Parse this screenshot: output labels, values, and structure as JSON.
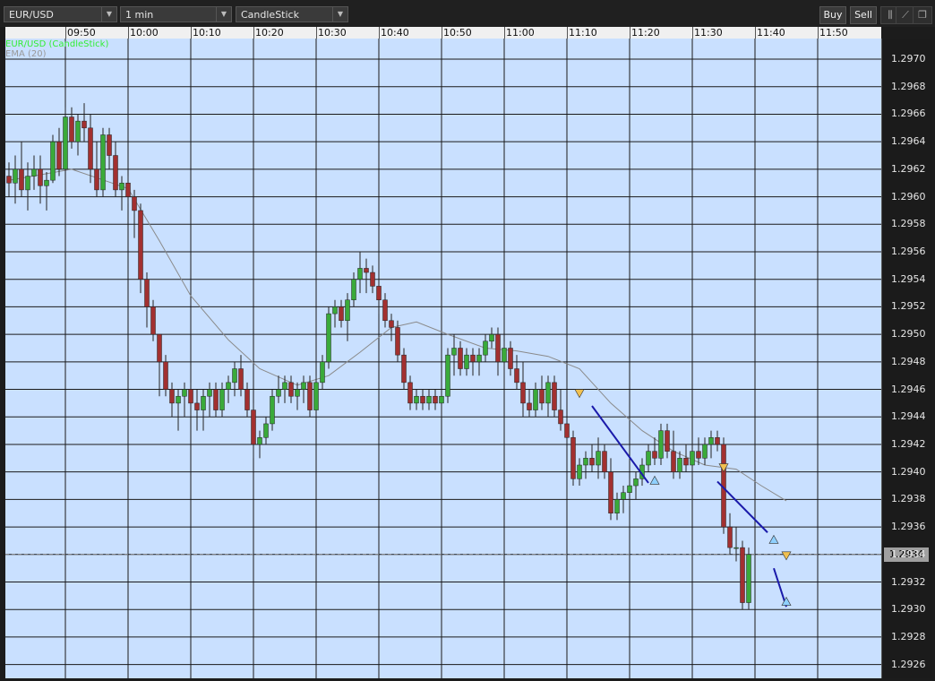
{
  "toolbar": {
    "symbol": "EUR/USD",
    "timeframe": "1 min",
    "chart_type": "CandleStick",
    "buy_label": "Buy",
    "sell_label": "Sell"
  },
  "colors": {
    "background": "#c9e0ff",
    "grid": "#1a1a1a",
    "bull": "#3aaa3a",
    "bear": "#a23030",
    "ema": "#8a8a8a",
    "trendline": "#1a1aaa",
    "signal_up": "#8fd0ff",
    "signal_down": "#f0c050",
    "symbol_legend": "#33ee33",
    "ema_legend": "#999999"
  },
  "legend": {
    "series": "EUR/USD (CandleStick)",
    "indicator": "EMA (20)"
  },
  "current_price": "1.2934",
  "chart_data": {
    "type": "candlestick",
    "x_ticks": [
      "09:50",
      "10:00",
      "10:10",
      "10:20",
      "10:30",
      "10:40",
      "10:50",
      "11:00",
      "11:10",
      "11:20",
      "11:30",
      "11:40",
      "11:50"
    ],
    "y_ticks": [
      "1.2970",
      "1.2968",
      "1.2966",
      "1.2964",
      "1.2962",
      "1.2960",
      "1.2958",
      "1.2956",
      "1.2954",
      "1.2952",
      "1.2950",
      "1.2948",
      "1.2946",
      "1.2944",
      "1.2942",
      "1.2940",
      "1.2938",
      "1.2936",
      "1.2934",
      "1.2932",
      "1.2930",
      "1.2928",
      "1.2926"
    ],
    "ylim": [
      1.2925,
      1.29715
    ],
    "x_start": "09:41",
    "interval_minutes": 1,
    "candles": [
      [
        1.29615,
        1.29625,
        1.296,
        1.2961
      ],
      [
        1.2961,
        1.2963,
        1.29595,
        1.2962
      ],
      [
        1.2962,
        1.2964,
        1.296,
        1.29605
      ],
      [
        1.29605,
        1.29625,
        1.2959,
        1.29615
      ],
      [
        1.29615,
        1.2963,
        1.29605,
        1.2962
      ],
      [
        1.2962,
        1.2963,
        1.29595,
        1.29608
      ],
      [
        1.29608,
        1.29618,
        1.2959,
        1.29612
      ],
      [
        1.29612,
        1.29645,
        1.2961,
        1.2964
      ],
      [
        1.2964,
        1.2965,
        1.29615,
        1.2962
      ],
      [
        1.2962,
        1.29665,
        1.29618,
        1.29658
      ],
      [
        1.29658,
        1.29665,
        1.29635,
        1.2964
      ],
      [
        1.2964,
        1.2966,
        1.2963,
        1.29655
      ],
      [
        1.29655,
        1.29668,
        1.2964,
        1.2965
      ],
      [
        1.2965,
        1.2966,
        1.2961,
        1.2962
      ],
      [
        1.2962,
        1.2964,
        1.296,
        1.29605
      ],
      [
        1.29605,
        1.2965,
        1.296,
        1.29645
      ],
      [
        1.29645,
        1.2965,
        1.2962,
        1.2963
      ],
      [
        1.2963,
        1.2964,
        1.296,
        1.29605
      ],
      [
        1.29605,
        1.29615,
        1.2959,
        1.2961
      ],
      [
        1.2961,
        1.29615,
        1.29595,
        1.296
      ],
      [
        1.296,
        1.29605,
        1.2957,
        1.2959
      ],
      [
        1.2959,
        1.29595,
        1.2953,
        1.2954
      ],
      [
        1.2954,
        1.29545,
        1.29505,
        1.2952
      ],
      [
        1.2952,
        1.29525,
        1.29495,
        1.295
      ],
      [
        1.295,
        1.295,
        1.29455,
        1.2948
      ],
      [
        1.2948,
        1.29485,
        1.29455,
        1.2946
      ],
      [
        1.2946,
        1.29465,
        1.2944,
        1.2945
      ],
      [
        1.2945,
        1.2946,
        1.2943,
        1.29455
      ],
      [
        1.29455,
        1.29465,
        1.2944,
        1.2946
      ],
      [
        1.2946,
        1.29465,
        1.2944,
        1.2945
      ],
      [
        1.2945,
        1.2946,
        1.2943,
        1.29445
      ],
      [
        1.29445,
        1.2946,
        1.2943,
        1.29455
      ],
      [
        1.29455,
        1.29465,
        1.2944,
        1.2946
      ],
      [
        1.2946,
        1.29465,
        1.2944,
        1.29445
      ],
      [
        1.29445,
        1.29465,
        1.2944,
        1.2946
      ],
      [
        1.2946,
        1.2947,
        1.2945,
        1.29465
      ],
      [
        1.29465,
        1.2948,
        1.29455,
        1.29475
      ],
      [
        1.29475,
        1.29485,
        1.29455,
        1.2946
      ],
      [
        1.2946,
        1.29465,
        1.2944,
        1.29445
      ],
      [
        1.29445,
        1.2945,
        1.2941,
        1.2942
      ],
      [
        1.2942,
        1.2943,
        1.2941,
        1.29425
      ],
      [
        1.29425,
        1.2944,
        1.2942,
        1.29435
      ],
      [
        1.29435,
        1.2946,
        1.2943,
        1.29455
      ],
      [
        1.29455,
        1.2947,
        1.2945,
        1.2946
      ],
      [
        1.2946,
        1.2947,
        1.2945,
        1.29465
      ],
      [
        1.29465,
        1.2947,
        1.2945,
        1.29455
      ],
      [
        1.29455,
        1.29465,
        1.29445,
        1.2946
      ],
      [
        1.2946,
        1.2947,
        1.2945,
        1.29465
      ],
      [
        1.29465,
        1.2947,
        1.2944,
        1.29445
      ],
      [
        1.29445,
        1.2947,
        1.2944,
        1.29465
      ],
      [
        1.29465,
        1.29485,
        1.2946,
        1.2948
      ],
      [
        1.2948,
        1.2952,
        1.29475,
        1.29515
      ],
      [
        1.29515,
        1.29525,
        1.29505,
        1.2952
      ],
      [
        1.2952,
        1.29525,
        1.29505,
        1.2951
      ],
      [
        1.2951,
        1.2953,
        1.29495,
        1.29525
      ],
      [
        1.29525,
        1.29545,
        1.2952,
        1.2954
      ],
      [
        1.2954,
        1.2956,
        1.2953,
        1.29548
      ],
      [
        1.29548,
        1.29555,
        1.2953,
        1.29545
      ],
      [
        1.29545,
        1.2955,
        1.2953,
        1.29535
      ],
      [
        1.29535,
        1.2954,
        1.29515,
        1.29525
      ],
      [
        1.29525,
        1.2953,
        1.29505,
        1.2951
      ],
      [
        1.2951,
        1.29515,
        1.29495,
        1.29505
      ],
      [
        1.29505,
        1.2951,
        1.2948,
        1.29485
      ],
      [
        1.29485,
        1.2949,
        1.2946,
        1.29465
      ],
      [
        1.29465,
        1.2947,
        1.29445,
        1.2945
      ],
      [
        1.2945,
        1.2946,
        1.29445,
        1.29455
      ],
      [
        1.29455,
        1.2946,
        1.29445,
        1.2945
      ],
      [
        1.2945,
        1.2946,
        1.29445,
        1.29455
      ],
      [
        1.29455,
        1.2946,
        1.29445,
        1.2945
      ],
      [
        1.2945,
        1.2946,
        1.2944,
        1.29455
      ],
      [
        1.29455,
        1.2949,
        1.2945,
        1.29485
      ],
      [
        1.29485,
        1.295,
        1.2947,
        1.2949
      ],
      [
        1.2949,
        1.29495,
        1.2947,
        1.29475
      ],
      [
        1.29475,
        1.2949,
        1.2947,
        1.29485
      ],
      [
        1.29485,
        1.2949,
        1.2947,
        1.2948
      ],
      [
        1.2948,
        1.2949,
        1.2947,
        1.29485
      ],
      [
        1.29485,
        1.295,
        1.2948,
        1.29495
      ],
      [
        1.29495,
        1.29505,
        1.2949,
        1.295
      ],
      [
        1.295,
        1.29505,
        1.2947,
        1.2948
      ],
      [
        1.2948,
        1.29495,
        1.2946,
        1.2949
      ],
      [
        1.2949,
        1.29495,
        1.2947,
        1.29475
      ],
      [
        1.29475,
        1.29485,
        1.2946,
        1.29465
      ],
      [
        1.29465,
        1.2948,
        1.2944,
        1.2945
      ],
      [
        1.2945,
        1.2946,
        1.2944,
        1.29445
      ],
      [
        1.29445,
        1.29465,
        1.2944,
        1.2946
      ],
      [
        1.2946,
        1.2947,
        1.29445,
        1.2945
      ],
      [
        1.2945,
        1.2947,
        1.2944,
        1.29465
      ],
      [
        1.29465,
        1.2947,
        1.2944,
        1.29445
      ],
      [
        1.29445,
        1.2946,
        1.2943,
        1.29435
      ],
      [
        1.29435,
        1.2944,
        1.2942,
        1.29425
      ],
      [
        1.29425,
        1.2943,
        1.2939,
        1.29395
      ],
      [
        1.29395,
        1.2941,
        1.2939,
        1.29405
      ],
      [
        1.29405,
        1.29415,
        1.29395,
        1.2941
      ],
      [
        1.2941,
        1.2942,
        1.294,
        1.29405
      ],
      [
        1.29405,
        1.29425,
        1.29395,
        1.29415
      ],
      [
        1.29415,
        1.2942,
        1.29395,
        1.294
      ],
      [
        1.294,
        1.2941,
        1.29365,
        1.2937
      ],
      [
        1.2937,
        1.29385,
        1.29365,
        1.2938
      ],
      [
        1.2938,
        1.2939,
        1.2937,
        1.29385
      ],
      [
        1.29385,
        1.29395,
        1.29375,
        1.2939
      ],
      [
        1.2939,
        1.294,
        1.2938,
        1.29395
      ],
      [
        1.29395,
        1.2941,
        1.2939,
        1.29405
      ],
      [
        1.29405,
        1.2942,
        1.294,
        1.29415
      ],
      [
        1.29415,
        1.29425,
        1.29405,
        1.2941
      ],
      [
        1.2941,
        1.29435,
        1.29405,
        1.2943
      ],
      [
        1.2943,
        1.29435,
        1.2941,
        1.29415
      ],
      [
        1.29415,
        1.2943,
        1.29395,
        1.294
      ],
      [
        1.294,
        1.29415,
        1.29395,
        1.2941
      ],
      [
        1.2941,
        1.2942,
        1.294,
        1.29405
      ],
      [
        1.29405,
        1.2942,
        1.29395,
        1.29415
      ],
      [
        1.29415,
        1.29425,
        1.29405,
        1.2941
      ],
      [
        1.2941,
        1.29425,
        1.29405,
        1.2942
      ],
      [
        1.2942,
        1.2943,
        1.2941,
        1.29425
      ],
      [
        1.29425,
        1.2943,
        1.29415,
        1.2942
      ],
      [
        1.2942,
        1.29425,
        1.29355,
        1.2936
      ],
      [
        1.2936,
        1.2937,
        1.2934,
        1.29345
      ],
      [
        1.29345,
        1.2936,
        1.29335,
        1.29345
      ],
      [
        1.29345,
        1.2935,
        1.293,
        1.29305
      ],
      [
        1.29305,
        1.29345,
        1.293,
        1.2934
      ]
    ],
    "ema": [
      [
        0,
        1.29612
      ],
      [
        10,
        1.2962
      ],
      [
        19,
        1.29606
      ],
      [
        24,
        1.29568
      ],
      [
        29,
        1.29528
      ],
      [
        35,
        1.29496
      ],
      [
        40,
        1.29475
      ],
      [
        46,
        1.29463
      ],
      [
        51,
        1.2947
      ],
      [
        56,
        1.29487
      ],
      [
        61,
        1.29505
      ],
      [
        65,
        1.29509
      ],
      [
        70,
        1.295
      ],
      [
        76,
        1.2949
      ],
      [
        81,
        1.29488
      ],
      [
        86,
        1.29484
      ],
      [
        91,
        1.29475
      ],
      [
        96,
        1.2945
      ],
      [
        101,
        1.2943
      ],
      [
        106,
        1.29415
      ],
      [
        111,
        1.29405
      ],
      [
        116,
        1.29402
      ],
      [
        120,
        1.2939
      ],
      [
        124,
        1.29379
      ]
    ],
    "trendlines": [
      [
        [
          93,
          1.29448
        ],
        [
          102,
          1.29392
        ]
      ],
      [
        [
          113,
          1.29393
        ],
        [
          121,
          1.29356
        ]
      ],
      [
        [
          122,
          1.2933
        ],
        [
          124,
          1.29302
        ]
      ]
    ],
    "signals": [
      {
        "dir": "down",
        "i": 91,
        "price": 1.29458
      },
      {
        "dir": "up",
        "i": 103,
        "price": 1.29393
      },
      {
        "dir": "down",
        "i": 114,
        "price": 1.29404
      },
      {
        "dir": "up",
        "i": 122,
        "price": 1.2935
      },
      {
        "dir": "down",
        "i": 124,
        "price": 1.2934
      },
      {
        "dir": "up",
        "i": 124,
        "price": 1.29305
      }
    ]
  }
}
